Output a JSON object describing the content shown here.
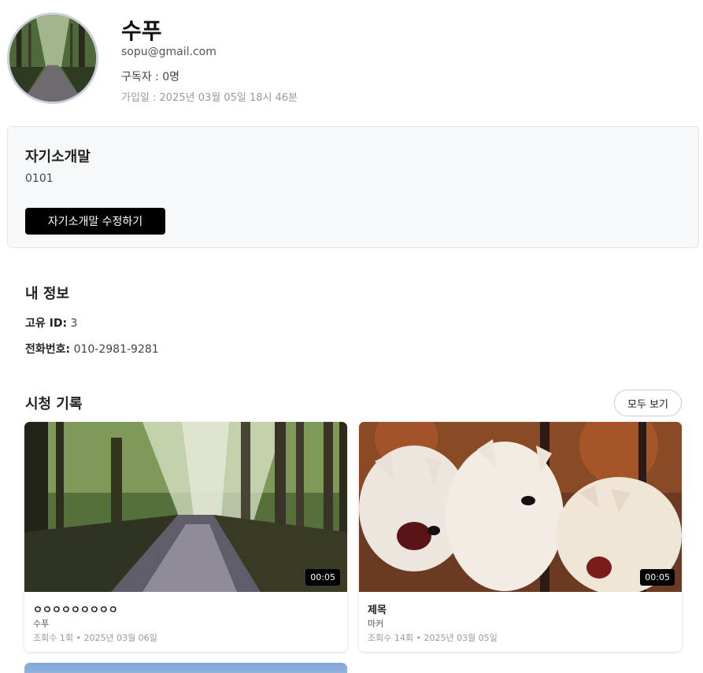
{
  "profile": {
    "name": "수푸",
    "email": "sopu@gmail.com",
    "subscribers": "구독자 : 0명",
    "joined": "가입일 : 2025년 03월 05일 18시 46분"
  },
  "intro": {
    "title": "자기소개말",
    "text": "0101",
    "edit_button": "자기소개말 수정하기"
  },
  "my_info": {
    "title": "내 정보",
    "id_label": "고유 ID:",
    "id_value": "3",
    "phone_label": "전화번호:",
    "phone_value": "010-2981-9281"
  },
  "history": {
    "title": "시청 기록",
    "view_all": "모두 보기",
    "videos": [
      {
        "title": "ㅇㅇㅇㅇㅇㅇㅇㅇㅇ",
        "author": "수푸",
        "meta": "조회수 1회 • 2025년 03월 06일",
        "duration": "00:05"
      },
      {
        "title": "제목",
        "author": "마커",
        "meta": "조회수 14회 • 2025년 03월 05일",
        "duration": "00:05"
      }
    ]
  }
}
